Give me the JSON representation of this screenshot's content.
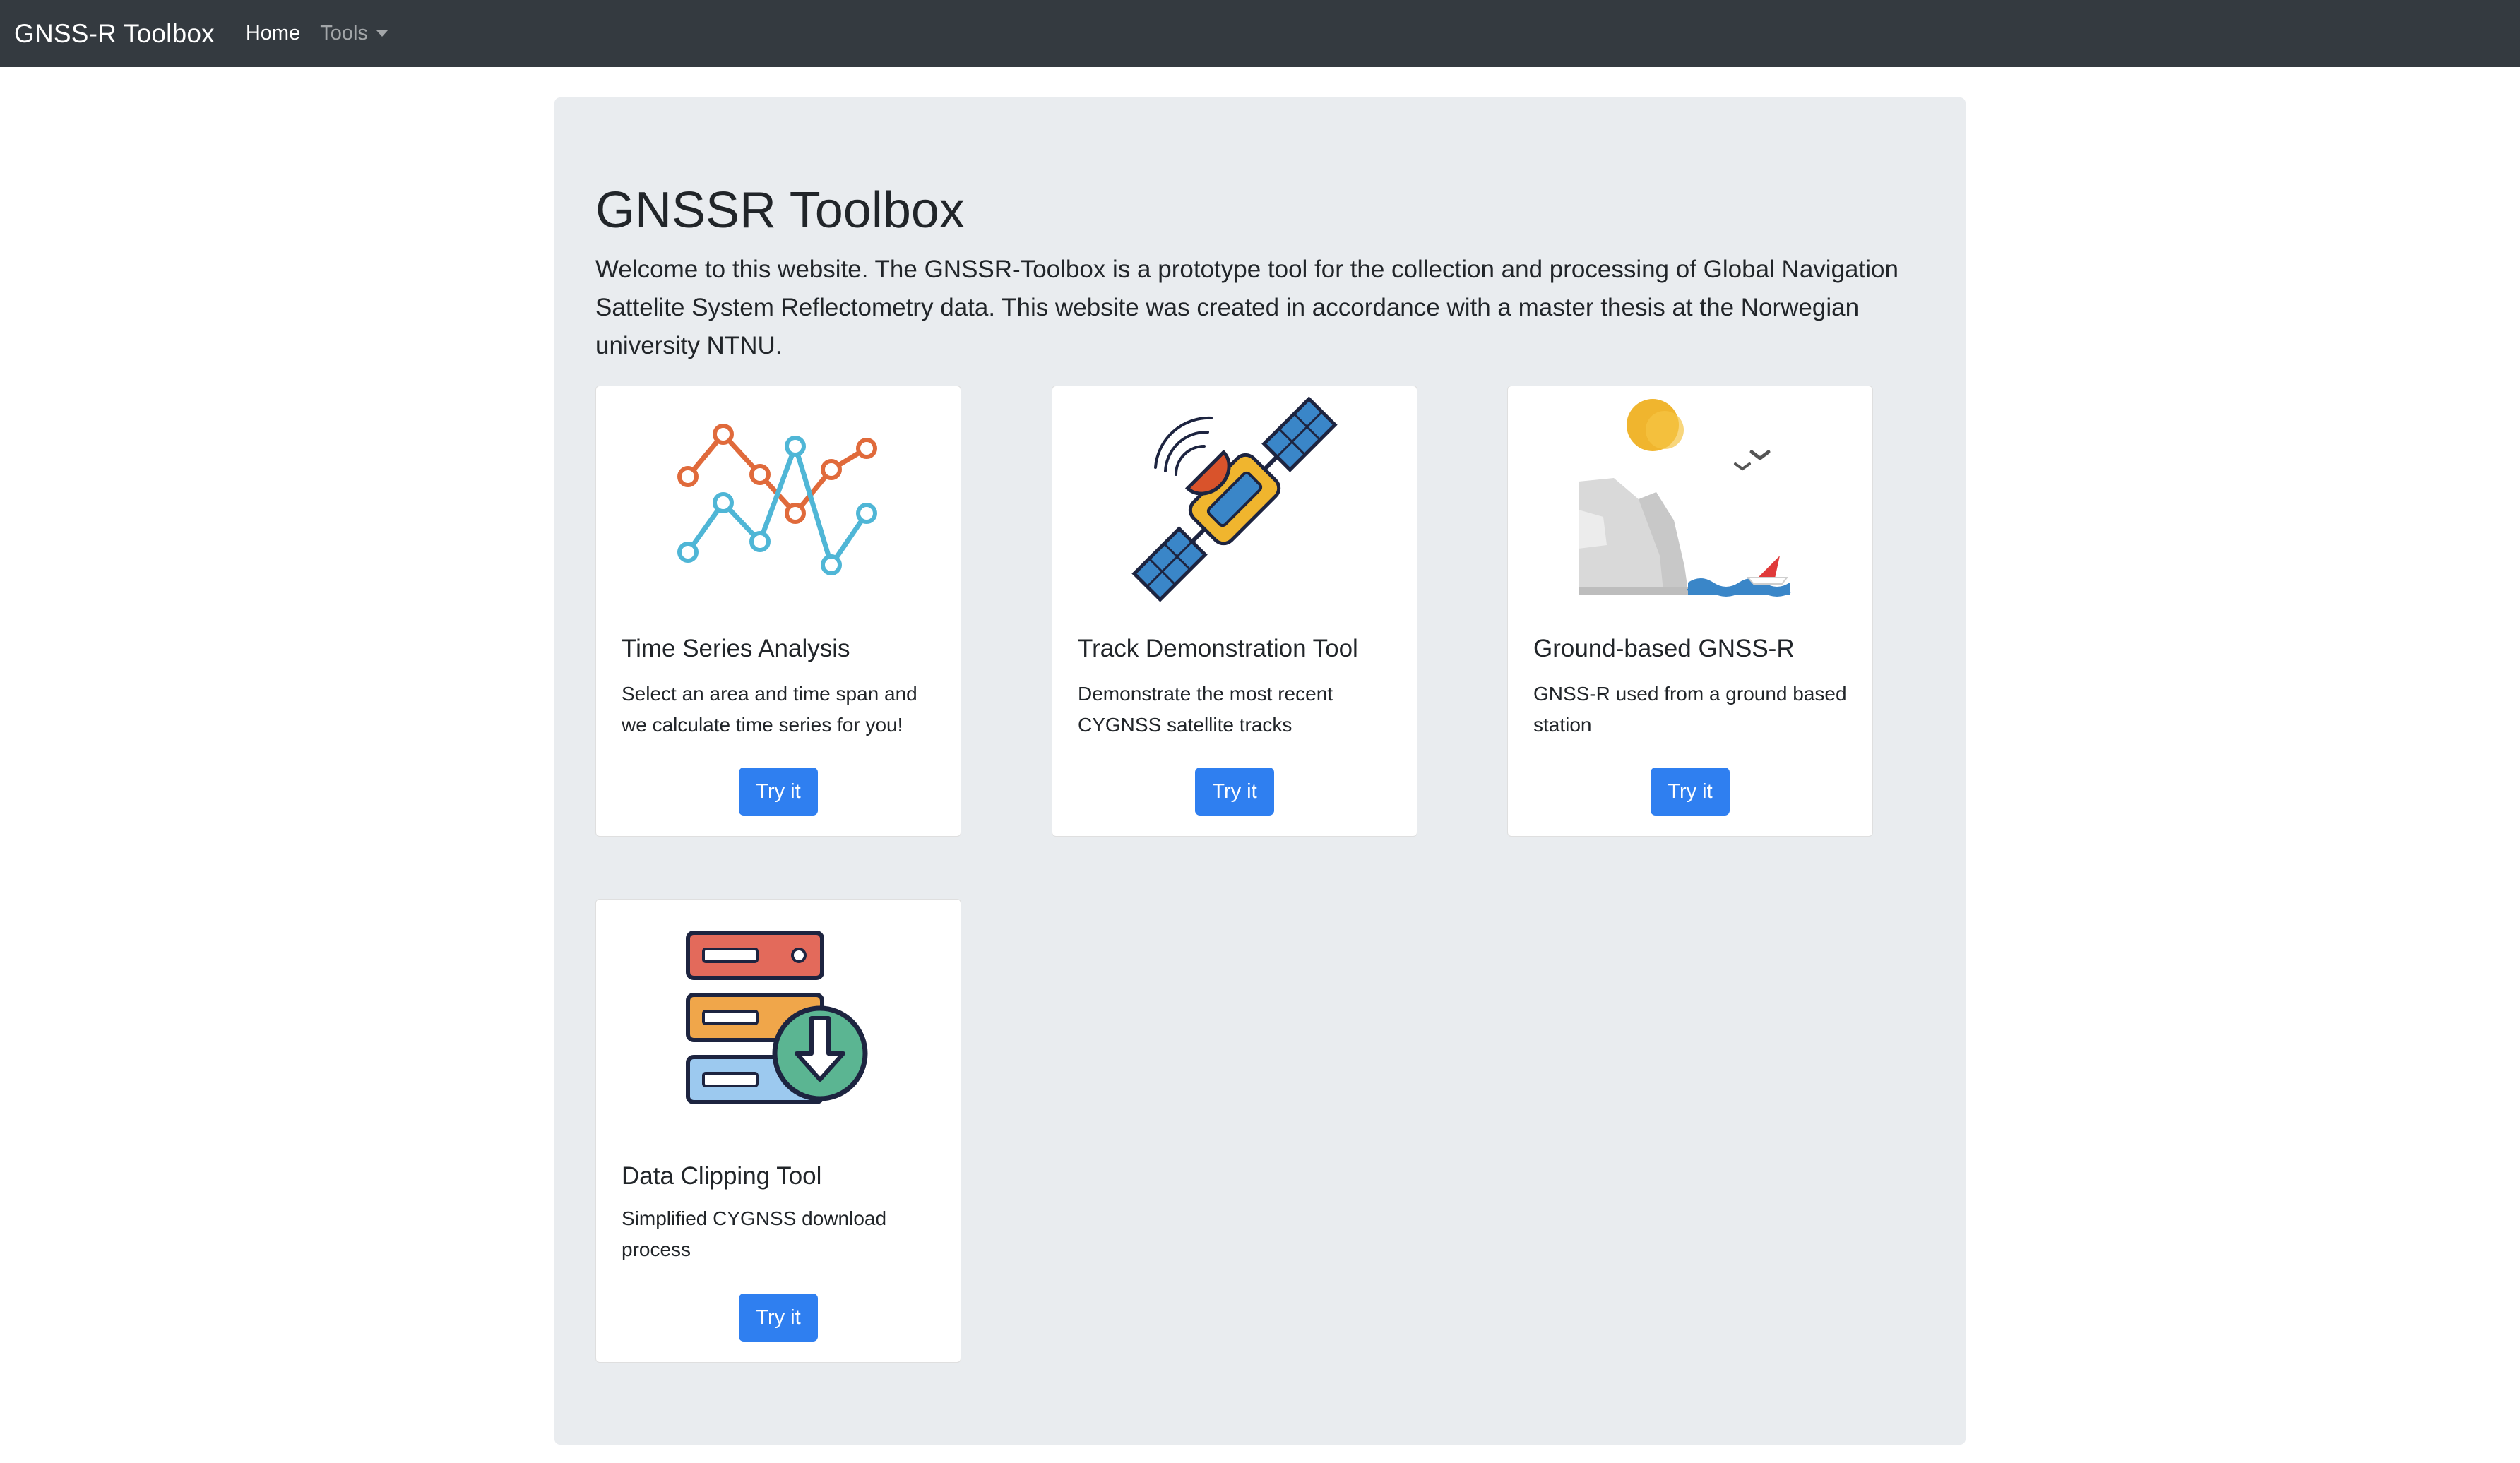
{
  "navbar": {
    "brand": "GNSS-R Toolbox",
    "home": "Home",
    "tools": "Tools"
  },
  "jumbotron": {
    "title": "GNSSR Toolbox",
    "lead": "Welcome to this website. The GNSSR-Toolbox is a prototype tool for the collection and processing of Global Navigation Sattelite System Reflectometry data. This website was created in accordance with a master thesis at the Norwegian university NTNU."
  },
  "cards": [
    {
      "title": "Time Series Analysis",
      "text": "Select an area and time span and we calculate time series for you!",
      "button": "Try it",
      "icon": "line-chart-icon"
    },
    {
      "title": "Track Demonstration Tool",
      "text": "Demonstrate the most recent CYGNSS satellite tracks",
      "button": "Try it",
      "icon": "satellite-icon"
    },
    {
      "title": "Ground-based GNSS-R",
      "text": "GNSS-R used from a ground based station",
      "button": "Try it",
      "icon": "coastal-landscape-icon"
    },
    {
      "title": "Data Clipping Tool",
      "text": "Simplified CYGNSS download process",
      "button": "Try it",
      "icon": "server-download-icon"
    }
  ],
  "colors": {
    "navbar": "#343a40",
    "jumbotron": "#e9ecef",
    "button": "#2f7ff0",
    "chart_orange": "#e06a3b",
    "chart_blue": "#4fb6d6"
  }
}
